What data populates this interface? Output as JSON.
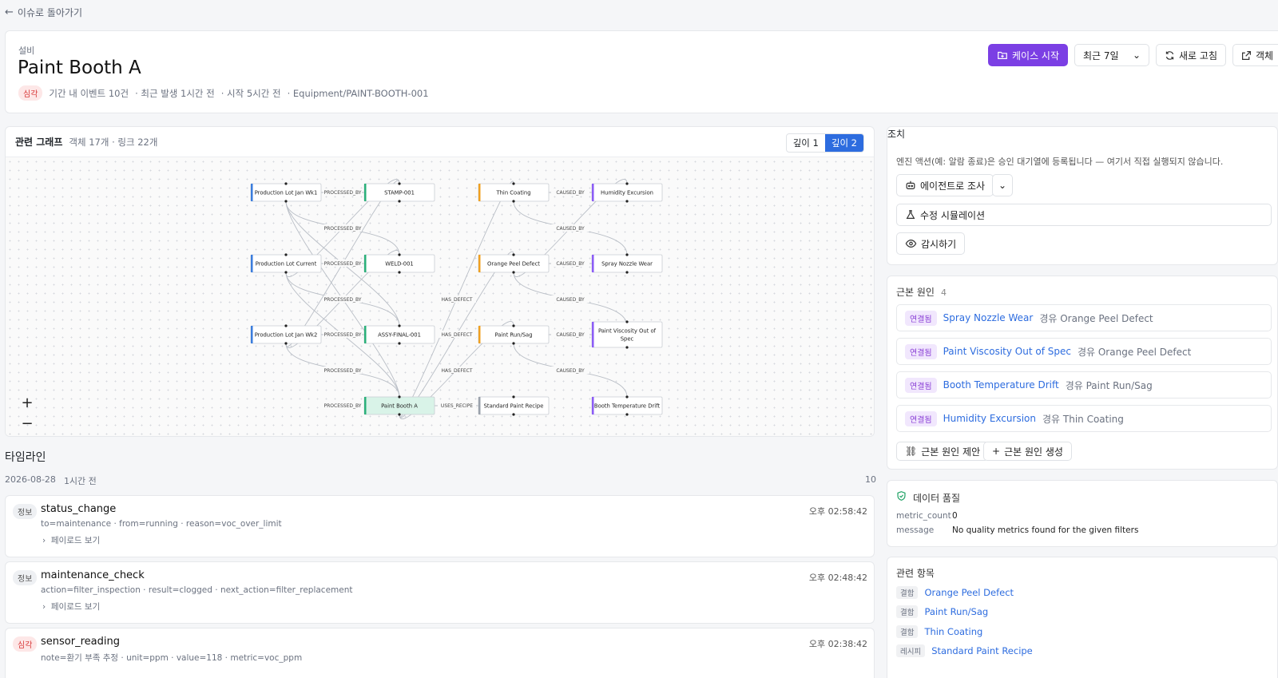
{
  "back": {
    "label": "이슈로 돌아가기"
  },
  "header": {
    "kind": "설비",
    "title": "Paint Booth A",
    "severity": "심각",
    "meta": [
      "기간 내 이벤트 10건",
      "· 최근 발생 1시간 전",
      "· 시작 5시간 전",
      "· Equipment/PAINT-BOOTH-001"
    ],
    "actions": {
      "start_case": "케이스 시작",
      "range": "최근 7일",
      "refresh": "새로 고침",
      "open": "객체"
    }
  },
  "graph": {
    "title": "관련 그래프",
    "summary": "객체 17개 · 링크 22개",
    "depth": [
      "깊이 1",
      "깊이 2"
    ],
    "nodes": [
      {
        "id": "lot1",
        "label": "Production Lot Jan Wk1",
        "color": "#3b7ddd"
      },
      {
        "id": "lotc",
        "label": "Production Lot Current",
        "color": "#3b7ddd"
      },
      {
        "id": "lot2",
        "label": "Production Lot Jan Wk2",
        "color": "#3b7ddd"
      },
      {
        "id": "stamp",
        "label": "STAMP-001",
        "color": "#2bb07a"
      },
      {
        "id": "weld",
        "label": "WELD-001",
        "color": "#2bb07a"
      },
      {
        "id": "assy",
        "label": "ASSY-FINAL-001",
        "color": "#2bb07a"
      },
      {
        "id": "pba",
        "label": "Paint Booth A",
        "color": "#2bb07a"
      },
      {
        "id": "thin",
        "label": "Thin Coating",
        "color": "#f0a020"
      },
      {
        "id": "orange",
        "label": "Orange Peel Defect",
        "color": "#f0a020"
      },
      {
        "id": "runsag",
        "label": "Paint Run/Sag",
        "color": "#f0a020"
      },
      {
        "id": "recipe",
        "label": "Standard Paint Recipe",
        "color": "#9aa1ab"
      },
      {
        "id": "humid",
        "label": "Humidity Excursion",
        "color": "#8b5cf6"
      },
      {
        "id": "nozzle",
        "label": "Spray Nozzle Wear",
        "color": "#8b5cf6"
      },
      {
        "id": "visc",
        "label": "Paint Viscosity Out of Spec",
        "color": "#8b5cf6"
      },
      {
        "id": "temp",
        "label": "Booth Temperature Drift",
        "color": "#8b5cf6"
      }
    ],
    "edge_labels": [
      "PROCESSED_BY",
      "PROCESSED_BY",
      "PROCESSED_BY",
      "PROCESSED_BY",
      "PROCESSED_BY",
      "PROCESSED_BY",
      "PROCESSED_BY",
      "PROCESSED_BY",
      "HAS_DEFECT",
      "HAS_DEFECT",
      "HAS_DEFECT",
      "USES_RECIPE",
      "CAUSED_BY",
      "CAUSED_BY",
      "CAUSED_BY",
      "CAUSED_BY",
      "CAUSED_BY",
      "CAUSED_BY",
      "CAUSED_BY"
    ]
  },
  "timeline": {
    "title": "타임라인",
    "date": "2026-08-28",
    "ago": "1시간 전",
    "count": "10",
    "events": [
      {
        "level": "정보",
        "name": "status_change",
        "kv": "to=maintenance · from=running · reason=voc_over_limit",
        "payload": "페이로드 보기",
        "time": "오후 02:58:42"
      },
      {
        "level": "정보",
        "name": "maintenance_check",
        "kv": "action=filter_inspection · result=clogged · next_action=filter_replacement",
        "payload": "페이로드 보기",
        "time": "오후 02:48:42"
      },
      {
        "level": "심각",
        "name": "sensor_reading",
        "kv": "note=환기 부족 추정 · unit=ppm · value=118 · metric=voc_ppm",
        "payload": "",
        "time": "오후 02:38:42"
      }
    ]
  },
  "actions_panel": {
    "title": "조치",
    "desc": "엔진 액션(예: 알람 종료)은 승인 대기열에 등록됩니다 — 여기서 직접 실행되지 않습니다.",
    "agent": "에이전트로 조사",
    "simulate": "수정 시뮬레이션",
    "watch": "감시하기"
  },
  "root_causes": {
    "title": "근본 원인",
    "count": "4",
    "items": [
      {
        "tag": "연결됨",
        "name": "Spray Nozzle Wear",
        "via": "경유 Orange Peel Defect"
      },
      {
        "tag": "연결됨",
        "name": "Paint Viscosity Out of Spec",
        "via": "경유 Orange Peel Defect"
      },
      {
        "tag": "연결됨",
        "name": "Booth Temperature Drift",
        "via": "경유 Paint Run/Sag"
      },
      {
        "tag": "연결됨",
        "name": "Humidity Excursion",
        "via": "경유 Thin Coating"
      }
    ],
    "suggest": "근본 원인 제안",
    "create": "근본 원인 생성"
  },
  "data_quality": {
    "title": "데이터 품질",
    "rows": [
      {
        "k": "metric_count",
        "v": "0"
      },
      {
        "k": "message",
        "v": "No quality metrics found for the given filters"
      }
    ]
  },
  "related": {
    "title": "관련 항목",
    "items": [
      {
        "tag": "결함",
        "name": "Orange Peel Defect"
      },
      {
        "tag": "결함",
        "name": "Paint Run/Sag"
      },
      {
        "tag": "결함",
        "name": "Thin Coating"
      },
      {
        "tag": "레시피",
        "name": "Standard Paint Recipe"
      }
    ]
  }
}
